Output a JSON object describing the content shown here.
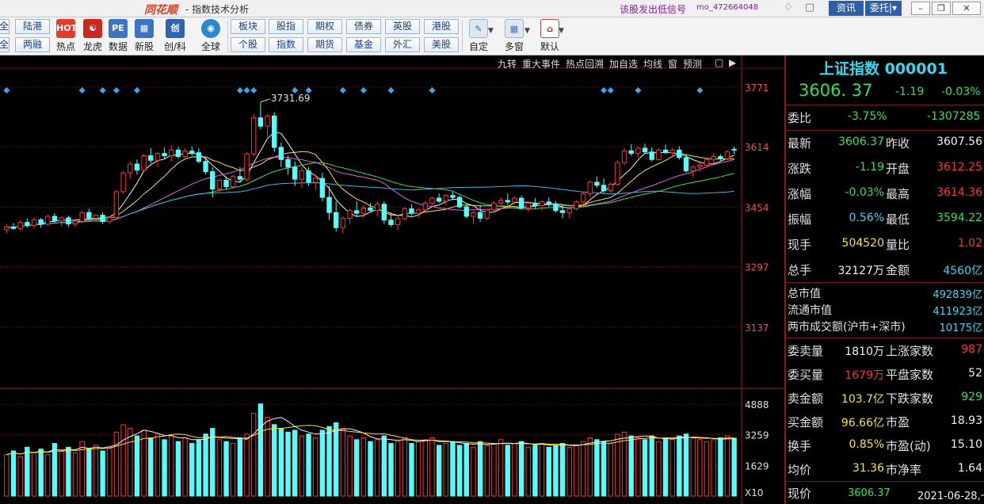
{
  "titlebar": {
    "logo": "同花顺",
    "title": "- 指数技术分析",
    "signal": "该股发出低信号",
    "user_id": "mo_472664048",
    "news_button": "资讯",
    "order_button": "委托|▾"
  },
  "toolbar": {
    "left_cut": [
      "全",
      "全"
    ],
    "pair_buttons": [
      {
        "top": "陆港",
        "bottom": "两融"
      },
      {
        "top": "板块",
        "bottom": "个股"
      },
      {
        "top": "股指",
        "bottom": "指数"
      },
      {
        "top": "期权",
        "bottom": "期货"
      },
      {
        "top": "债券",
        "bottom": "基金"
      },
      {
        "top": "英股",
        "bottom": "外汇"
      },
      {
        "top": "港股",
        "bottom": "美股"
      }
    ],
    "tools": [
      "热点",
      "龙虎",
      "数据",
      "新股",
      "创/科",
      "全球",
      "自定",
      "多窗",
      "默认"
    ]
  },
  "chart_menu": [
    "九转",
    "重大事件",
    "热点回溯",
    "加自选",
    "均线",
    "窗",
    "预测"
  ],
  "price_axis": [
    "3771",
    "3614",
    "3454",
    "3297",
    "3137"
  ],
  "volume_axis": [
    "4888",
    "3259",
    "1629",
    "X10"
  ],
  "high_label": "3731.69",
  "panel": {
    "index_name": "上证指数 000001",
    "last_price": "3606. 37",
    "change": "-1.19",
    "change_pct": "-0.03%",
    "wei_bi_label": "委比",
    "wei_bi_pct": "-3.75%",
    "wei_bi_diff": "-1307285",
    "quote_rows": [
      {
        "l1": "最新",
        "v1": "3606.37",
        "c1": "green",
        "l2": "昨收",
        "v2": "3607.56",
        "c2": "white"
      },
      {
        "l1": "涨跌",
        "v1": "-1.19",
        "c1": "green",
        "l2": "开盘",
        "v2": "3612.25",
        "c2": "red"
      },
      {
        "l1": "涨幅",
        "v1": "-0.03%",
        "c1": "green",
        "l2": "最高",
        "v2": "3614.36",
        "c2": "red"
      },
      {
        "l1": "振幅",
        "v1": "0.56%",
        "c1": "cyan",
        "l2": "最低",
        "v2": "3594.22",
        "c2": "green"
      },
      {
        "l1": "现手",
        "v1": "504520",
        "c1": "yel",
        "l2": "量比",
        "v2": "1.02",
        "c2": "red"
      },
      {
        "l1": "总手",
        "v1": "32127万",
        "c1": "white",
        "l2": "金额",
        "v2": "4560亿",
        "c2": "cyan"
      }
    ],
    "market_rows": [
      {
        "label": "总市值",
        "value": "492839亿"
      },
      {
        "label": "流通市值",
        "value": "411923亿"
      },
      {
        "label": "两市成交额(沪市+深市)",
        "value": "10175亿"
      }
    ],
    "stat_rows": [
      {
        "l1": "委卖量",
        "v1": "1810万",
        "c1": "white",
        "l2": "上涨家数",
        "v2": "987",
        "c2": "red"
      },
      {
        "l1": "委买量",
        "v1": "1679万",
        "c1": "red",
        "l2": "平盘家数",
        "v2": "52",
        "c2": "white"
      },
      {
        "l1": "卖金额",
        "v1": "103.7亿",
        "c1": "yel",
        "l2": "下跌家数",
        "v2": "929",
        "c2": "green"
      },
      {
        "l1": "买金额",
        "v1": "96.66亿",
        "c1": "yel",
        "l2": "市盈",
        "v2": "18.93",
        "c2": "white"
      },
      {
        "l1": "换手",
        "v1": "0.85%",
        "c1": "yel",
        "l2": "市盈(动)",
        "v2": "15.10",
        "c2": "white"
      },
      {
        "l1": "均价",
        "v1": "31.36",
        "c1": "yel",
        "l2": "市净率",
        "v2": "1.64",
        "c2": "white"
      }
    ],
    "footer": {
      "label": "现价",
      "price": "3606.37",
      "date": "2021-06-28,一"
    }
  },
  "chart_data": {
    "type": "candlestick",
    "price_ticks": [
      3771,
      3614,
      3454,
      3297,
      3137
    ],
    "volume_ticks": [
      4888,
      3259,
      1629
    ],
    "high_marker": 3731.69,
    "series": [
      {
        "name": "K线",
        "ohlc": [
          [
            3395,
            3410,
            3385,
            3402
          ],
          [
            3402,
            3412,
            3394,
            3398
          ],
          [
            3398,
            3420,
            3392,
            3414
          ],
          [
            3414,
            3424,
            3400,
            3406
          ],
          [
            3406,
            3428,
            3398,
            3421
          ],
          [
            3421,
            3426,
            3400,
            3409
          ],
          [
            3409,
            3435,
            3405,
            3430
          ],
          [
            3430,
            3438,
            3412,
            3418
          ],
          [
            3418,
            3430,
            3404,
            3426
          ],
          [
            3426,
            3432,
            3402,
            3410
          ],
          [
            3410,
            3424,
            3400,
            3417
          ],
          [
            3417,
            3445,
            3412,
            3440
          ],
          [
            3440,
            3450,
            3420,
            3425
          ],
          [
            3425,
            3436,
            3418,
            3433
          ],
          [
            3433,
            3440,
            3410,
            3416
          ],
          [
            3416,
            3430,
            3410,
            3427
          ],
          [
            3427,
            3500,
            3420,
            3495
          ],
          [
            3495,
            3550,
            3488,
            3545
          ],
          [
            3545,
            3575,
            3530,
            3568
          ],
          [
            3568,
            3580,
            3540,
            3552
          ],
          [
            3552,
            3595,
            3548,
            3590
          ],
          [
            3590,
            3610,
            3570,
            3578
          ],
          [
            3578,
            3600,
            3560,
            3596
          ],
          [
            3596,
            3612,
            3580,
            3590
          ],
          [
            3590,
            3618,
            3575,
            3605
          ],
          [
            3605,
            3614,
            3582,
            3588
          ],
          [
            3588,
            3610,
            3578,
            3602
          ],
          [
            3602,
            3615,
            3590,
            3598
          ],
          [
            3598,
            3610,
            3570,
            3575
          ],
          [
            3575,
            3585,
            3540,
            3548
          ],
          [
            3548,
            3560,
            3480,
            3502
          ],
          [
            3502,
            3530,
            3495,
            3525
          ],
          [
            3525,
            3535,
            3500,
            3508
          ],
          [
            3508,
            3540,
            3502,
            3535
          ],
          [
            3535,
            3560,
            3520,
            3528
          ],
          [
            3528,
            3600,
            3522,
            3595
          ],
          [
            3595,
            3700,
            3590,
            3690
          ],
          [
            3690,
            3731,
            3660,
            3668
          ],
          [
            3668,
            3700,
            3640,
            3695
          ],
          [
            3695,
            3705,
            3600,
            3612
          ],
          [
            3612,
            3625,
            3560,
            3580
          ],
          [
            3580,
            3590,
            3540,
            3560
          ],
          [
            3560,
            3575,
            3510,
            3528
          ],
          [
            3528,
            3560,
            3505,
            3550
          ],
          [
            3550,
            3560,
            3510,
            3520
          ],
          [
            3520,
            3540,
            3500,
            3530
          ],
          [
            3530,
            3545,
            3470,
            3480
          ],
          [
            3480,
            3510,
            3420,
            3440
          ],
          [
            3440,
            3470,
            3390,
            3400
          ],
          [
            3400,
            3430,
            3385,
            3425
          ],
          [
            3425,
            3450,
            3410,
            3445
          ],
          [
            3445,
            3470,
            3430,
            3438
          ],
          [
            3438,
            3460,
            3425,
            3452
          ],
          [
            3452,
            3465,
            3440,
            3446
          ],
          [
            3446,
            3470,
            3430,
            3462
          ],
          [
            3462,
            3470,
            3410,
            3420
          ],
          [
            3420,
            3440,
            3402,
            3408
          ],
          [
            3408,
            3430,
            3395,
            3424
          ],
          [
            3424,
            3455,
            3418,
            3450
          ],
          [
            3450,
            3462,
            3432,
            3438
          ],
          [
            3438,
            3452,
            3425,
            3447
          ],
          [
            3447,
            3470,
            3440,
            3465
          ],
          [
            3465,
            3482,
            3455,
            3478
          ],
          [
            3478,
            3490,
            3465,
            3470
          ],
          [
            3470,
            3488,
            3460,
            3485
          ],
          [
            3485,
            3495,
            3472,
            3480
          ],
          [
            3480,
            3485,
            3450,
            3455
          ],
          [
            3455,
            3465,
            3425,
            3430
          ],
          [
            3430,
            3445,
            3410,
            3440
          ],
          [
            3440,
            3460,
            3415,
            3425
          ],
          [
            3425,
            3450,
            3420,
            3447
          ],
          [
            3447,
            3470,
            3440,
            3465
          ],
          [
            3465,
            3480,
            3455,
            3472
          ],
          [
            3472,
            3490,
            3460,
            3468
          ],
          [
            3468,
            3482,
            3462,
            3478
          ],
          [
            3478,
            3485,
            3448,
            3452
          ],
          [
            3452,
            3470,
            3442,
            3465
          ],
          [
            3465,
            3478,
            3450,
            3458
          ],
          [
            3458,
            3472,
            3445,
            3468
          ],
          [
            3468,
            3480,
            3455,
            3462
          ],
          [
            3462,
            3470,
            3440,
            3445
          ],
          [
            3445,
            3460,
            3425,
            3440
          ],
          [
            3440,
            3455,
            3425,
            3450
          ],
          [
            3450,
            3472,
            3445,
            3468
          ],
          [
            3468,
            3495,
            3460,
            3490
          ],
          [
            3490,
            3525,
            3482,
            3520
          ],
          [
            3520,
            3535,
            3505,
            3512
          ],
          [
            3512,
            3530,
            3490,
            3498
          ],
          [
            3498,
            3520,
            3492,
            3515
          ],
          [
            3515,
            3578,
            3510,
            3572
          ],
          [
            3572,
            3610,
            3565,
            3603
          ],
          [
            3603,
            3620,
            3590,
            3596
          ],
          [
            3596,
            3615,
            3585,
            3610
          ],
          [
            3610,
            3622,
            3595,
            3600
          ],
          [
            3600,
            3612,
            3575,
            3580
          ],
          [
            3580,
            3610,
            3578,
            3605
          ],
          [
            3605,
            3620,
            3595,
            3598
          ],
          [
            3598,
            3610,
            3585,
            3605
          ],
          [
            3605,
            3615,
            3580,
            3585
          ],
          [
            3585,
            3595,
            3545,
            3550
          ],
          [
            3550,
            3565,
            3535,
            3560
          ],
          [
            3560,
            3572,
            3548,
            3565
          ],
          [
            3565,
            3585,
            3560,
            3580
          ],
          [
            3580,
            3595,
            3570,
            3588
          ],
          [
            3588,
            3594,
            3575,
            3582
          ],
          [
            3582,
            3605,
            3578,
            3600
          ],
          [
            3607,
            3614,
            3594,
            3606
          ]
        ]
      },
      {
        "name": "成交量",
        "values": [
          2200,
          2400,
          2100,
          2600,
          2300,
          2500,
          2200,
          2800,
          2400,
          2600,
          2300,
          2900,
          2500,
          2700,
          2400,
          2600,
          3400,
          3800,
          3600,
          3200,
          3500,
          3100,
          3300,
          3000,
          3200,
          2900,
          3100,
          2800,
          3000,
          3300,
          3600,
          3000,
          2900,
          2800,
          3100,
          3300,
          4400,
          4900,
          4200,
          3800,
          3600,
          3400,
          3500,
          3200,
          3300,
          3100,
          3500,
          3700,
          3900,
          3600,
          3200,
          3000,
          3100,
          2900,
          3000,
          3200,
          2800,
          2900,
          3100,
          2800,
          2900,
          3000,
          3100,
          2700,
          2800,
          2900,
          2700,
          2800,
          2600,
          2900,
          2700,
          2800,
          3000,
          2700,
          2800,
          2900,
          2600,
          2700,
          2800,
          2600,
          2700,
          2800,
          2600,
          2700,
          2900,
          3100,
          3000,
          2900,
          2800,
          3300,
          3400,
          3200,
          3100,
          3000,
          3200,
          2900,
          3100,
          3000,
          3200,
          3300,
          3100,
          3000,
          2900,
          3000,
          3100,
          3200,
          3080
        ]
      }
    ]
  }
}
